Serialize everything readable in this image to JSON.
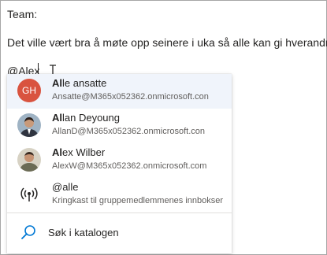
{
  "message": {
    "greeting": "Team:",
    "body": "Det ville vært bra å møte opp seinere i uka så alle kan gi hverandre",
    "mention_text": "@Alex"
  },
  "suggestions": [
    {
      "match": "Al",
      "rest": "le ansatte",
      "email": "Ansatte@M365x052362.onmicrosoft.con",
      "initials": "GH",
      "avatar_color": "#d9533f"
    },
    {
      "match": "Al",
      "rest": "lan Deyoung",
      "email": "AllanD@M365x052362.onmicrosoft.con"
    },
    {
      "match": "Al",
      "rest": "ex Wilber",
      "email": "AlexW@M365x052362.onmicrosoft.com"
    },
    {
      "match": "",
      "rest": "@alle",
      "email": "Kringkast til gruppemedlemmenes innbokser",
      "icon": "broadcast-icon"
    }
  ],
  "search": {
    "label": "Søk i katalogen",
    "icon": "search-icon"
  },
  "colors": {
    "accent": "#0078d4",
    "selected_bg": "#f0f4fb"
  }
}
